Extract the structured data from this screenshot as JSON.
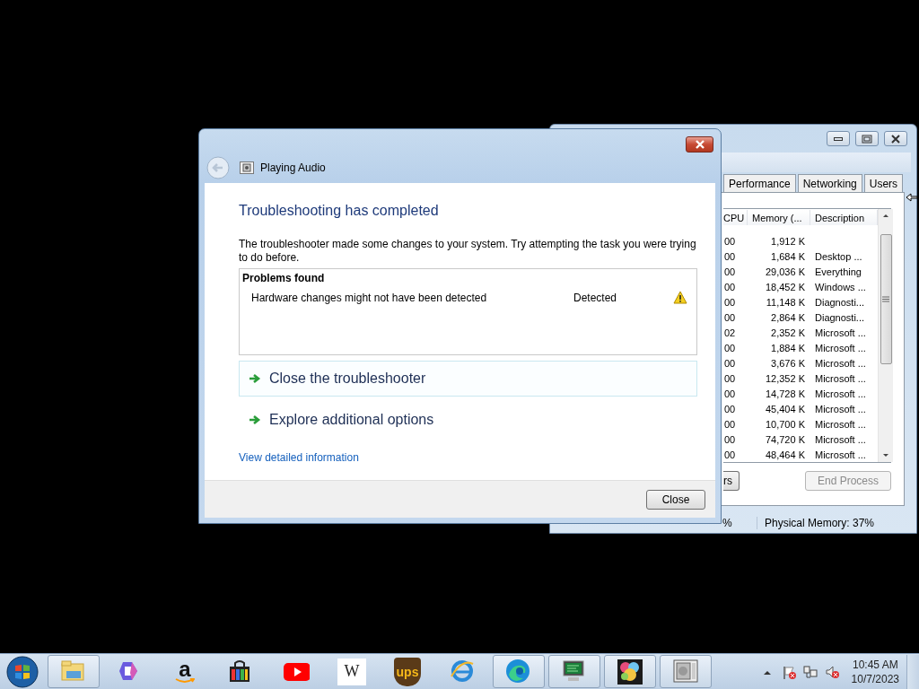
{
  "task_manager": {
    "tabs": [
      {
        "label": "Performance",
        "selected": false
      },
      {
        "label": "Networking",
        "selected": false
      },
      {
        "label": "Users",
        "selected": false
      }
    ],
    "columns": [
      "CPU",
      "Memory (...",
      "Description"
    ],
    "rows": [
      {
        "cpu": "00",
        "memory": "1,912 K"
      },
      {
        "cpu": "00",
        "memory": "1,684 K",
        "description": "Desktop ..."
      },
      {
        "cpu": "00",
        "memory": "29,036 K",
        "description": "Everything"
      },
      {
        "cpu": "00",
        "memory": "18,452 K",
        "description": "Windows ..."
      },
      {
        "cpu": "00",
        "memory": "11,148 K",
        "description": "Diagnosti..."
      },
      {
        "cpu": "00",
        "memory": "2,864 K",
        "description": "Diagnosti..."
      },
      {
        "cpu": "02",
        "memory": "2,352 K",
        "description": "Microsoft ..."
      },
      {
        "cpu": "00",
        "memory": "1,884 K",
        "description": "Microsoft ..."
      },
      {
        "cpu": "00",
        "memory": "3,676 K",
        "description": "Microsoft ..."
      },
      {
        "cpu": "00",
        "memory": "12,352 K",
        "description": "Microsoft ..."
      },
      {
        "cpu": "00",
        "memory": "14,728 K",
        "description": "Microsoft ..."
      },
      {
        "cpu": "00",
        "memory": "45,404 K",
        "description": "Microsoft ..."
      },
      {
        "cpu": "00",
        "memory": "10,700 K",
        "description": "Microsoft ..."
      },
      {
        "cpu": "00",
        "memory": "74,720 K",
        "description": "Microsoft ..."
      },
      {
        "cpu": "00",
        "memory": "48,464 K",
        "description": "Microsoft ..."
      }
    ],
    "buttons": [
      {
        "label": "rs",
        "disabled": false
      },
      {
        "label": "End Process",
        "disabled": true
      }
    ],
    "status_bar": [
      "%",
      "Physical Memory: 37%"
    ]
  },
  "dialog": {
    "title": "Playing Audio",
    "heading": "Troubleshooting has completed",
    "message": "The troubleshooter made some changes to your system. Try attempting the task you were trying to do before.",
    "problems": {
      "title": "Problems found",
      "items": [
        {
          "problem": "Hardware changes might not have been detected",
          "status": "Detected",
          "kind": "warning"
        }
      ]
    },
    "options": [
      {
        "label": "Close the troubleshooter",
        "highlighted": true
      },
      {
        "label": "Explore additional options",
        "highlighted": false
      }
    ],
    "details_link": "View detailed information",
    "button": "Close"
  },
  "taskbar": {
    "items": [
      {
        "kind": "folder",
        "running": true
      },
      {
        "kind": "copilot",
        "running": false
      },
      {
        "kind": "amazon",
        "label": "a",
        "running": false
      },
      {
        "kind": "bag",
        "running": false
      },
      {
        "kind": "play",
        "running": false
      },
      {
        "kind": "wiki",
        "label": "W",
        "running": false
      },
      {
        "kind": "ups",
        "label": "ups",
        "running": false
      },
      {
        "kind": "ie",
        "running": false
      },
      {
        "kind": "edge",
        "running": true
      },
      {
        "kind": "monitor",
        "running": true
      },
      {
        "kind": "paint",
        "running": true
      },
      {
        "kind": "disk",
        "running": true
      }
    ],
    "tray": [
      {
        "kind": "arrow"
      },
      {
        "kind": "flag"
      },
      {
        "kind": "network"
      },
      {
        "kind": "volume"
      }
    ],
    "time": "10:45 AM",
    "date": "10/7/2023"
  }
}
